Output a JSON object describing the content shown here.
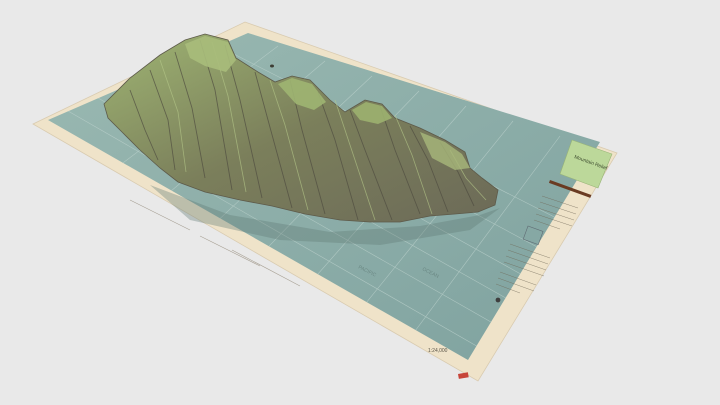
{
  "scene": {
    "background_color": "#e9e9e9",
    "map_border_color": "#efe3c9",
    "ocean_color": "#8fb0ab",
    "terrain_light": "#a7b97a",
    "terrain_mid": "#7f8f5d",
    "terrain_dark": "#5b5546",
    "legend_panel_color": "#bcd89a",
    "legend_title": "Mountain Relief",
    "scale_label": "1:24,000",
    "ocean_labels": [
      "PACIFIC",
      "OCEAN"
    ]
  }
}
